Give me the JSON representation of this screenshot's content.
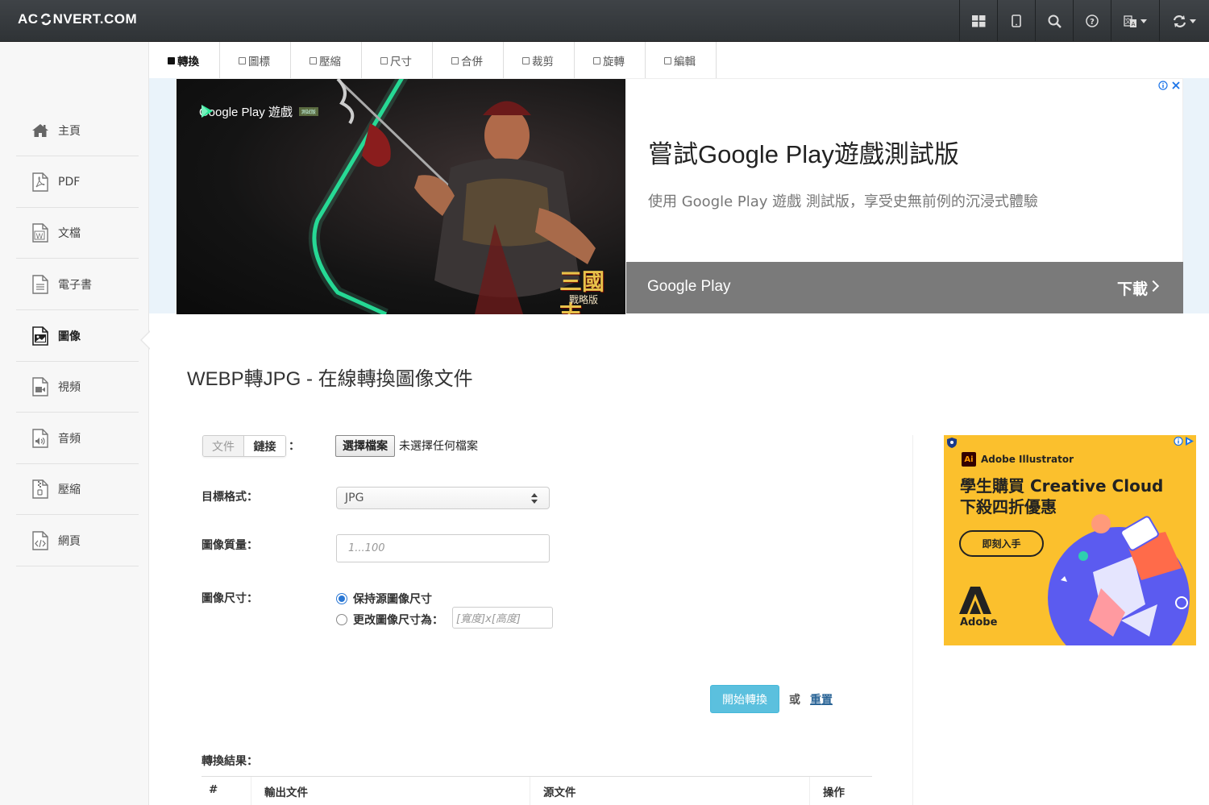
{
  "header": {
    "logo_prefix": "AC",
    "logo_suffix": "NVERT.COM",
    "icons": [
      "grid-icon",
      "tablet-icon",
      "search-icon",
      "help-icon",
      "language-icon",
      "refresh-icon"
    ]
  },
  "sidebar": {
    "items": [
      {
        "label": "主頁",
        "icon": "home-icon"
      },
      {
        "label": "PDF",
        "icon": "pdf-file-icon"
      },
      {
        "label": "文檔",
        "icon": "word-file-icon"
      },
      {
        "label": "電子書",
        "icon": "ebook-file-icon"
      },
      {
        "label": "圖像",
        "icon": "image-file-icon"
      },
      {
        "label": "視頻",
        "icon": "video-file-icon"
      },
      {
        "label": "音頻",
        "icon": "audio-file-icon"
      },
      {
        "label": "壓縮",
        "icon": "archive-file-icon"
      },
      {
        "label": "網頁",
        "icon": "code-file-icon"
      }
    ],
    "active_index": 4
  },
  "tabs": [
    {
      "label": "轉換",
      "active": true
    },
    {
      "label": "圖標",
      "active": false
    },
    {
      "label": "壓縮",
      "active": false
    },
    {
      "label": "尺寸",
      "active": false
    },
    {
      "label": "合併",
      "active": false
    },
    {
      "label": "裁剪",
      "active": false
    },
    {
      "label": "旋轉",
      "active": false
    },
    {
      "label": "編輯",
      "active": false
    }
  ],
  "ad_top": {
    "brand": "Google Play 遊戲",
    "brand_badge": "測試版",
    "game_logo": "三國志",
    "game_logo_sub": "戰略版",
    "title": "嘗試Google Play遊戲測試版",
    "subtitle": "使用 Google Play 遊戲 測試版，享受史無前例的沉浸式體驗",
    "bar_label": "Google Play",
    "download": "下載"
  },
  "main": {
    "page_title": "WEBP轉JPG - 在線轉換圖像文件",
    "source_tabs": [
      "文件",
      "鏈接"
    ],
    "colon": "：",
    "file_button": "選擇檔案",
    "file_status": "未選擇任何檔案",
    "target_label": "目標格式：",
    "target_value": "JPG",
    "quality_label": "圖像質量：",
    "quality_placeholder": "1...100",
    "size_label": "圖像尺寸：",
    "size_keep": "保持源圖像尺寸",
    "size_change": "更改圖像尺寸為：",
    "size_placeholder": "[寬度]x[高度]",
    "start_button": "開始轉換",
    "or": "或",
    "reset": "重置",
    "results_label": "轉換結果：",
    "table_headers": [
      "#",
      "輸出文件",
      "源文件",
      "操作"
    ]
  },
  "ad_right": {
    "product": "Adobe Illustrator",
    "product_badge": "Ai",
    "headline_1": "學生購買 Creative Cloud",
    "headline_2": "下殺四折優惠",
    "cta": "即刻入手",
    "brand": "Adobe"
  },
  "colors": {
    "topbar": "#35393c",
    "accent": "#5bc0de",
    "link": "#2a6496",
    "ad_yellow": "#fbc02d"
  }
}
